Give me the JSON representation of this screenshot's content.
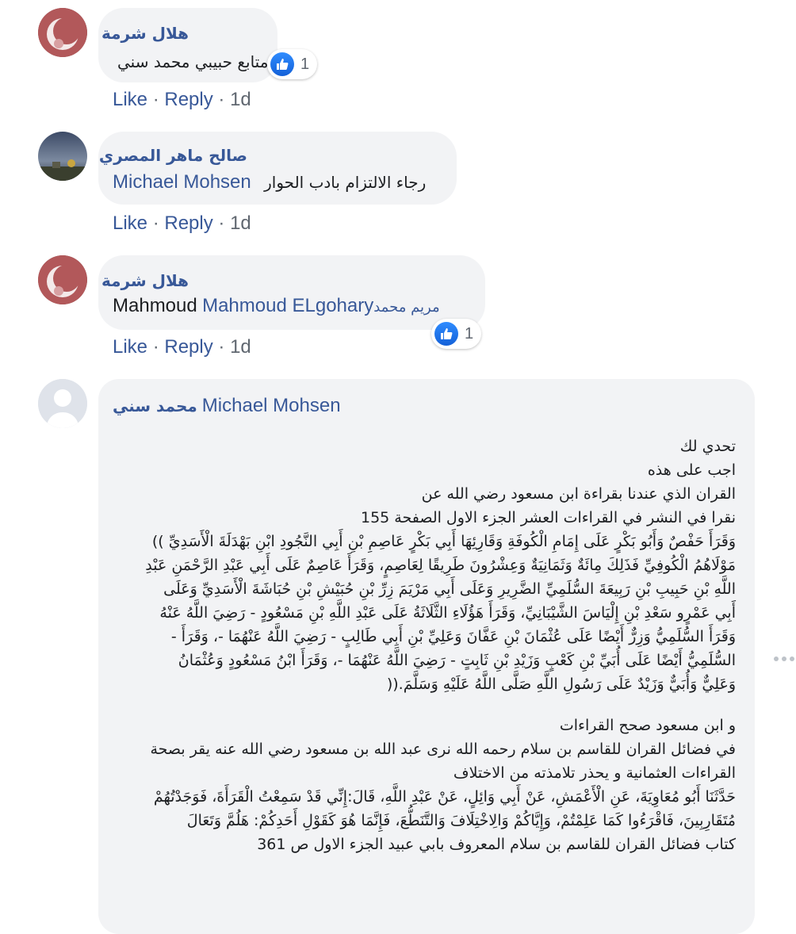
{
  "comments": [
    {
      "author": "هلال شرمة",
      "text": "متابع حبيبي محمد سني",
      "reaction_count": "1",
      "actions": {
        "like": "Like",
        "reply": "Reply",
        "time": "1d"
      }
    },
    {
      "author": "صالح ماهر المصري",
      "mention": "Michael Mohsen",
      "text": "رجاء الالتزام بادب الحوار",
      "actions": {
        "like": "Like",
        "reply": "Reply",
        "time": "1d"
      }
    },
    {
      "author": "هلال شرمة",
      "mention_plain": "Mahmoud",
      "mention": "Mahmoud ELgohary",
      "mention_ar": "مريم محمد",
      "reaction_count": "1",
      "actions": {
        "like": "Like",
        "reply": "Reply",
        "time": "1d"
      }
    },
    {
      "author": "محمد سني",
      "mention": "Michael Mohsen",
      "lines": [
        "تحدي لك",
        "اجب على هذه",
        "القران الذي عندنا بقراءة ابن مسعود رضي الله عن",
        "نقرا في النشر في القراءات العشر الجزء الاول الصفحة 155",
        "وَقَرَأَ حَفْصٌ وَأَبُو بَكْرٍ عَلَى إِمَامِ الْكُوفَةِ وَقَارِئِهَا أَبِي بَكْرٍ عَاصِمِ بْنِ أَبِي النَّجُودِ ابْنِ بَهْدَلَةَ الْأَسَدِيِّ ))",
        "مَوْلَاهُمُ الْكُوفِيِّ فَذَلِكَ مِائَةٌ وَثَمَانِيَةٌ وَعِشْرُونَ طَرِيقًا لِعَاصِمٍ، وَقَرَأَ عَاصِمٌ عَلَى أَبِي عَبْدِ الرَّحْمَنِ عَبْدِ",
        "اللَّهِ بْنِ حَبِيبِ بْنِ رَبِيعَةَ السُّلَمِيِّ الضَّرِيرِ وَعَلَى أَبِي مَرْيَمَ زِرِّ بْنِ حُبَيْشِ بْنِ حُبَاشَةَ الْأَسَدِيِّ وَعَلَى",
        "أَبِي عَمْرٍو سَعْدِ بْنِ إِلْيَاسَ الشَّيْبَانِيِّ، وَقَرَأَ هَؤُلَاءِ الثَّلَاثَةُ عَلَى عَبْدِ اللَّهِ بْنِ مَسْعُودٍ - رَضِيَ اللَّهُ عَنْهُ",
        "وَقَرَأَ السُّلَمِيُّ وَزِرٌّ أَيْضًا عَلَى عُثْمَانَ بْنِ عَفَّانَ وَعَلِيِّ بْنِ أَبِي طَالِبٍ - رَضِيَ اللَّهُ عَنْهُمَا -، وَقَرَأَ -",
        "السُّلَمِيُّ أَيْضًا عَلَى أُبَيِّ بْنِ كَعْبٍ وَزَيْدِ بْنِ ثَابِتٍ - رَضِيَ اللَّهُ عَنْهُمَا -، وَقَرَأَ ابْنُ مَسْعُودٍ وَعُثْمَانُ",
        "وَعَلِيٌّ وَأُبَيٌّ وَزَيْدٌ عَلَى رَسُولِ اللَّهِ صَلَّى اللَّهُ عَلَيْهِ وَسَلَّمَ.((",
        "",
        "و ابن مسعود صحح القراءات",
        "في فضائل القران للقاسم بن سلام رحمه الله نرى عبد الله بن مسعود رضي الله عنه يقر بصحة",
        "القراءات العثمانية و يحذر تلامذته من الاختلاف",
        "حَدَّثَنَا أَبُو مُعَاوِيَةَ، عَنِ الْأَعْمَشِ، عَنْ أَبِي وَائِلٍ، عَنْ عَبْدِ اللَّهِ، قَالَ:إِنِّي قَدْ سَمِعْتُ الْقَرَأَةَ، فَوَجَدْتُهُمْ",
        "مُتَقَارِبِينَ، فَاقْرَءُوا كَمَا عَلِمْتُمْ، وَإِيَّاكُمْ وَالِاخْتِلَافَ وَالتَّنَطُّعَ، فَإِنَّمَا هُوَ كَقَوْلِ أَحَدِكُمْ: هَلُمَّ وَتَعَالَ",
        "كتاب فضائل القران للقاسم بن سلام المعروف بابي عبيد الجزء الاول ص 361"
      ]
    }
  ]
}
